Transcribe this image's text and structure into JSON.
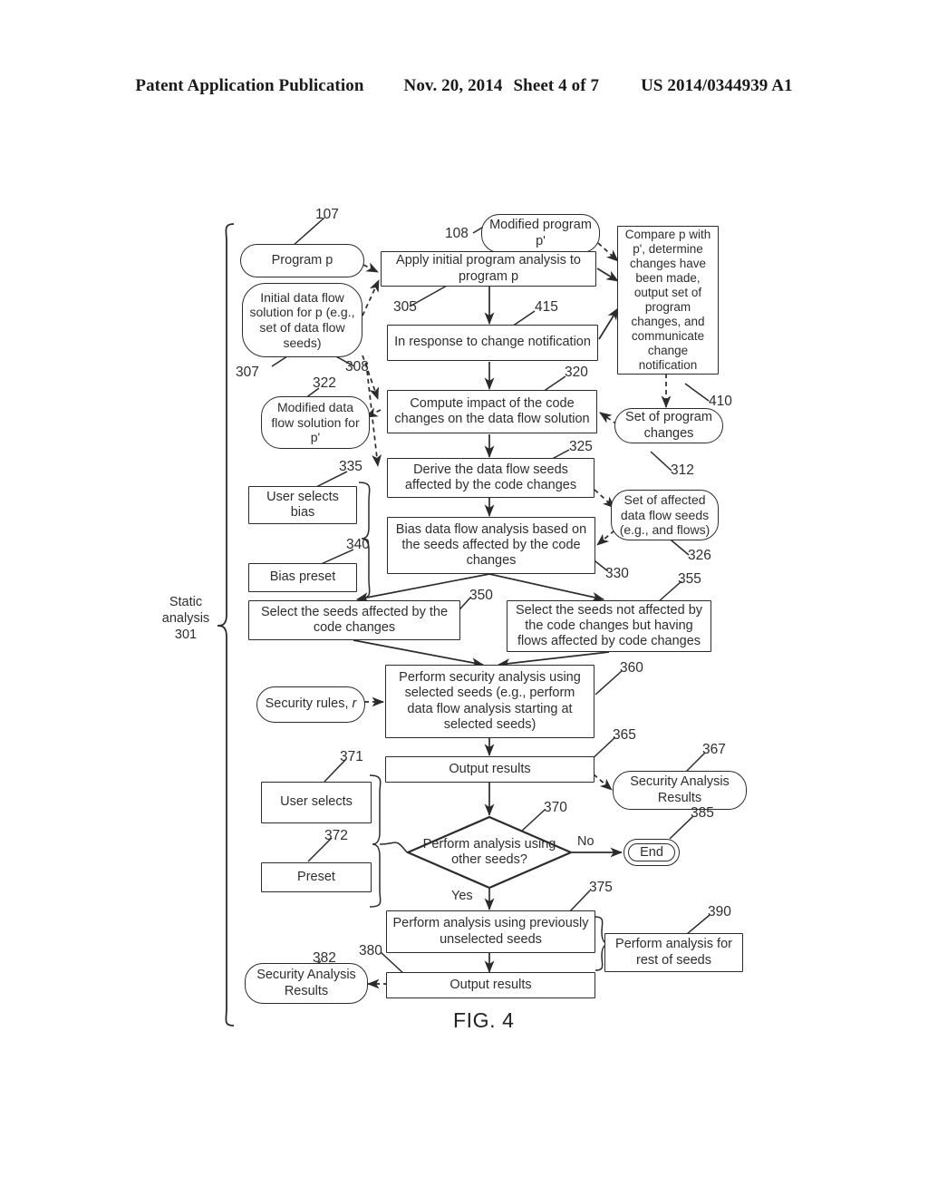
{
  "header": {
    "title": "Patent Application Publication",
    "date": "Nov. 20, 2014",
    "sheet": "Sheet 4 of 7",
    "number": "US 2014/0344939 A1"
  },
  "figure": {
    "caption": "FIG. 4",
    "group_label": "Static\nanalysis\n301",
    "edge_labels": {
      "no": "No",
      "yes": "Yes"
    }
  },
  "nodes": {
    "program_p": {
      "label": "Program p",
      "ref": "107",
      "shape": "round"
    },
    "initial_solution": {
      "label": "Initial data flow solution for p (e.g., set of data flow seeds)",
      "ref": "307",
      "shape": "round"
    },
    "modified_program": {
      "label": "Modified program p'",
      "ref": "108",
      "shape": "round"
    },
    "apply_initial": {
      "label": "Apply initial program analysis to program p",
      "ref": "305",
      "shape": "rect"
    },
    "compare_p": {
      "label": "Compare p with p', determine changes have been made, output set of program changes, and communicate change notification",
      "ref": "410",
      "shape": "rect"
    },
    "in_response": {
      "label": "In response to change notification",
      "ref": "415",
      "shape": "rect"
    },
    "set_program_changes": {
      "label": "Set of program changes",
      "ref": "312",
      "shape": "round"
    },
    "modified_solution": {
      "label": "Modified data flow solution for p'",
      "ref": "322",
      "shape": "round"
    },
    "compute_impact": {
      "label": "Compute impact of the code changes on the data flow solution",
      "ref": "320",
      "shape": "rect"
    },
    "derive_seeds": {
      "label": "Derive the data flow seeds affected by the code changes",
      "ref": "325",
      "shape": "rect"
    },
    "set_affected_seeds": {
      "label": "Set of affected data flow seeds (e.g., and flows)",
      "ref": "326",
      "shape": "round"
    },
    "user_selects_bias": {
      "label": "User selects bias",
      "ref": "335",
      "shape": "rect"
    },
    "bias_preset": {
      "label": "Bias preset",
      "ref": "340",
      "shape": "rect"
    },
    "bias_analysis": {
      "label": "Bias data flow analysis based on the seeds affected by the code changes",
      "ref": "330",
      "shape": "rect"
    },
    "select_affected": {
      "label": "Select the seeds affected by the code changes",
      "ref": "350",
      "shape": "rect"
    },
    "select_not_affected": {
      "label": "Select the seeds not affected by the code changes but having flows affected by code changes",
      "ref": "355",
      "shape": "rect"
    },
    "security_rules": {
      "label": "Security rules, r",
      "shape": "round"
    },
    "perform_security": {
      "label": "Perform security analysis using selected seeds (e.g., perform data flow analysis starting at selected seeds)",
      "ref": "360",
      "shape": "rect"
    },
    "output_results_1": {
      "label": "Output results",
      "ref": "365",
      "shape": "rect"
    },
    "security_results_1": {
      "label": "Security Analysis Results",
      "ref": "367",
      "shape": "round"
    },
    "user_selects": {
      "label": "User selects",
      "ref": "371",
      "shape": "rect"
    },
    "preset": {
      "label": "Preset",
      "ref": "372",
      "shape": "rect"
    },
    "decision": {
      "label": "Perform analysis using other seeds?",
      "ref": "370",
      "shape": "diamond"
    },
    "end": {
      "label": "End",
      "ref": "385",
      "shape": "terminator"
    },
    "perform_unselected": {
      "label": "Perform analysis using previously unselected seeds",
      "ref": "375",
      "shape": "rect"
    },
    "perform_rest": {
      "label": "Perform analysis for rest of seeds",
      "ref": "390",
      "shape": "rect"
    },
    "output_results_2": {
      "label": "Output results",
      "ref": "380",
      "shape": "rect"
    },
    "security_results_2": {
      "label": "Security Analysis Results",
      "ref": "382",
      "shape": "round"
    }
  },
  "extra_refs": {
    "seeds_308": "308"
  },
  "colors": {
    "ink": "#2b2b2b",
    "text": "#2e2e2e",
    "paper": "#ffffff"
  }
}
